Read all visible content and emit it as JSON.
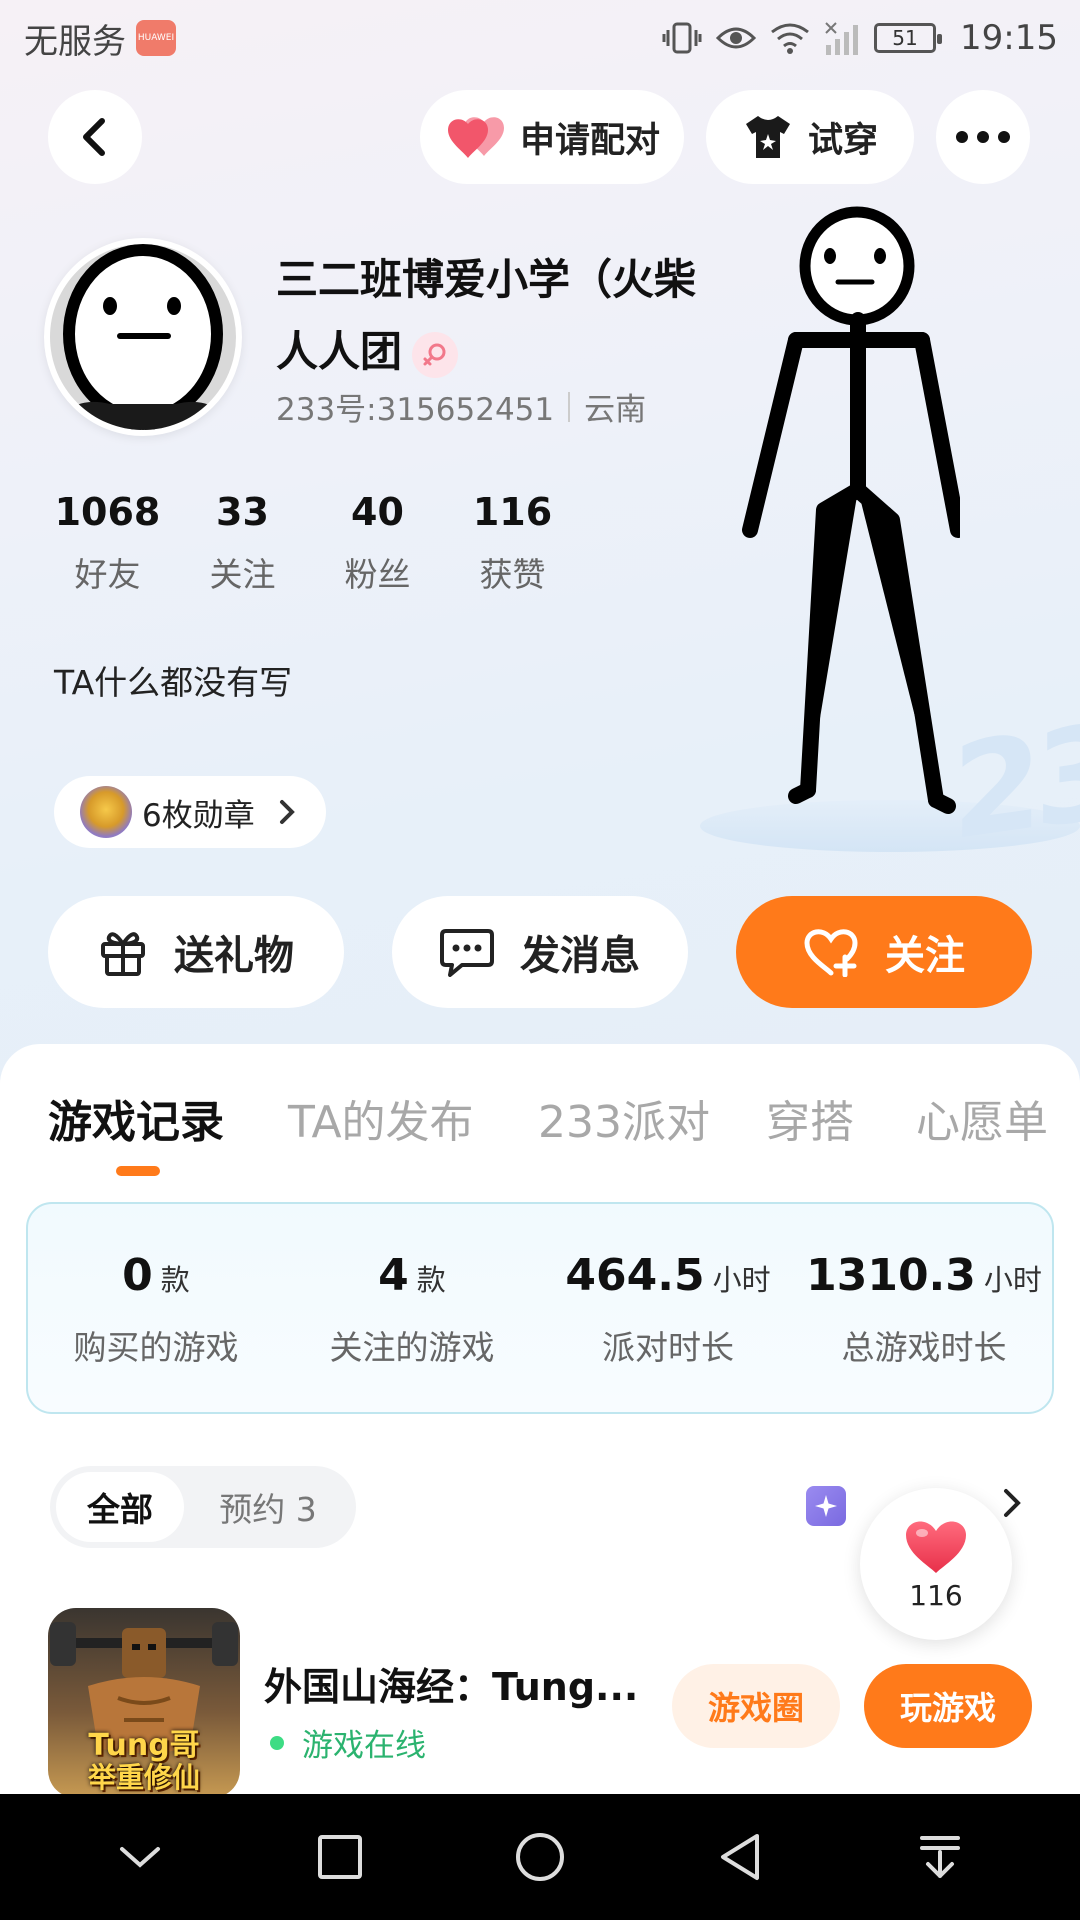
{
  "status_bar": {
    "carrier": "无服务",
    "brand_badge": "HUAWEI",
    "battery": "51",
    "time": "19:15"
  },
  "header": {
    "pair_label": "申请配对",
    "tryon_label": "试穿"
  },
  "profile": {
    "name": "三二班博爱小学（火柴人人团",
    "uid": "233号:315652451",
    "location": "云南",
    "bio": "TA什么都没有写",
    "medals_label": "6枚勋章",
    "stats": [
      {
        "value": "1068",
        "label": "好友"
      },
      {
        "value": "33",
        "label": "关注"
      },
      {
        "value": "40",
        "label": "粉丝"
      },
      {
        "value": "116",
        "label": "获赞"
      }
    ],
    "decor_text": "233"
  },
  "actions": {
    "gift": "送礼物",
    "message": "发消息",
    "follow": "关注"
  },
  "tabs": [
    "游戏记录",
    "TA的发布",
    "233派对",
    "穿搭",
    "心愿单"
  ],
  "game_stats": [
    {
      "value": "0",
      "unit": "款",
      "label": "购买的游戏"
    },
    {
      "value": "4",
      "unit": "款",
      "label": "关注的游戏"
    },
    {
      "value": "464.5",
      "unit": "小时",
      "label": "派对时长"
    },
    {
      "value": "1310.3",
      "unit": "小时",
      "label": "总游戏时长"
    }
  ],
  "filter": {
    "all": "全部",
    "reserved": "预约 3"
  },
  "likes": {
    "count": "116"
  },
  "game": {
    "title": "外国山海经：Tung...",
    "status": "游戏在线",
    "icon_text_1": "Tung哥",
    "icon_text_2": "举重修仙",
    "circle_label": "游戏圈",
    "play_label": "玩游戏"
  },
  "colors": {
    "accent": "#ff7a1a",
    "online": "#2bb36f",
    "heart": "#f2566b"
  }
}
